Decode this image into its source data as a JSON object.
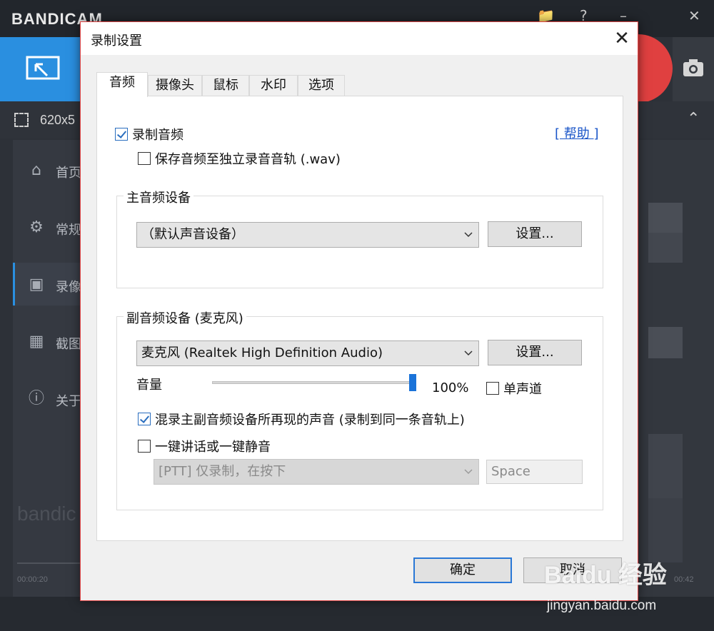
{
  "app": {
    "logo": "BANDICAM",
    "capture_size": "620x5",
    "sidebar": [
      {
        "label": "首页",
        "icon": "home-icon"
      },
      {
        "label": "常规",
        "icon": "gear-icon"
      },
      {
        "label": "录像",
        "icon": "video-settings-icon"
      },
      {
        "label": "截图",
        "icon": "image-settings-icon"
      },
      {
        "label": "关于",
        "icon": "info-icon"
      }
    ],
    "watermark": "bandic",
    "time_start": "00:00:20",
    "time_end": "00:42"
  },
  "dialog": {
    "title": "录制设置",
    "close_glyph": "✕",
    "tabs": [
      {
        "label": "音频",
        "active": true
      },
      {
        "label": "摄像头",
        "active": false
      },
      {
        "label": "鼠标",
        "active": false
      },
      {
        "label": "水印",
        "active": false
      },
      {
        "label": "选项",
        "active": false
      }
    ],
    "record_audio": {
      "label": "录制音频",
      "checked": true
    },
    "separate_track": {
      "label": "保存音频至独立录音音轨 (.wav)",
      "checked": false
    },
    "help_link": "[ 帮助 ]",
    "primary_device": {
      "group_title": "主音频设备",
      "selected": "（默认声音设备）",
      "settings_label": "设置..."
    },
    "secondary_device": {
      "group_title": "副音频设备 (麦克风)",
      "selected": "麦克风 (Realtek High Definition Audio)",
      "settings_label": "设置...",
      "volume_label": "音量",
      "volume_value": "100%",
      "volume_level": 1.0,
      "mono": {
        "label": "单声道",
        "checked": false
      },
      "mix": {
        "label": "混录主副音频设备所再现的声音 (录制到同一条音轨上)",
        "checked": true
      },
      "ptt": {
        "label": "一键讲话或一键静音",
        "checked": false
      },
      "ptt_mode": "[PTT] 仅录制，在按下",
      "ptt_key": "Space"
    },
    "ok_label": "确定",
    "cancel_label": "取消"
  },
  "overlay": {
    "baidu_logo": "Baidu 经验",
    "baidu_url": "jingyan.baidu.com"
  },
  "colors": {
    "accent": "#2a8fe0",
    "record": "#e04040",
    "dialog_border": "#e04646",
    "link": "#1a55c8"
  }
}
